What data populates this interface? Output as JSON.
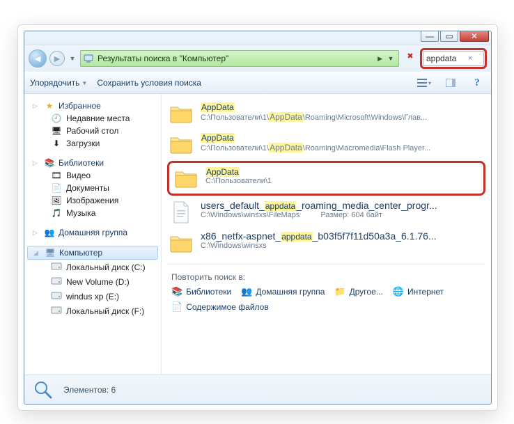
{
  "window_controls": {
    "min": "—",
    "max": "▭",
    "close": "✕"
  },
  "address": {
    "text": "Результаты поиска в \"Компьютер\"",
    "stop_tooltip": "Остановить"
  },
  "search": {
    "value": "appdata",
    "clear": "×"
  },
  "toolbar": {
    "organize": "Упорядочить",
    "save_conditions": "Сохранить условия поиска",
    "help_glyph": "?"
  },
  "sidebar": {
    "favorites": {
      "label": "Избранное",
      "items": [
        {
          "label": "Недавние места",
          "icon": "🕘"
        },
        {
          "label": "Рабочий стол",
          "icon": "🖥"
        },
        {
          "label": "Загрузки",
          "icon": "⬇"
        }
      ]
    },
    "libraries": {
      "label": "Библиотеки",
      "items": [
        {
          "label": "Видео",
          "icon": "🎞"
        },
        {
          "label": "Документы",
          "icon": "📄"
        },
        {
          "label": "Изображения",
          "icon": "🖼"
        },
        {
          "label": "Музыка",
          "icon": "🎵"
        }
      ]
    },
    "homegroup": {
      "label": "Домашняя группа"
    },
    "computer": {
      "label": "Компьютер",
      "items": [
        {
          "label": "Локальный диск (C:)"
        },
        {
          "label": "New Volume (D:)"
        },
        {
          "label": "windus xp (E:)"
        },
        {
          "label": "Локальный диск (F:)"
        }
      ]
    }
  },
  "results": [
    {
      "type": "folder",
      "title": "AppData",
      "title_hl": [
        [
          0,
          7
        ]
      ],
      "path_pre": "C:\\Пользователи\\1\\",
      "path_hl": "AppData",
      "path_post": "\\Roaming\\Microsoft\\Windows\\Глав..."
    },
    {
      "type": "folder",
      "title": "AppData",
      "title_hl": [
        [
          0,
          7
        ]
      ],
      "path_pre": "C:\\Пользователи\\1\\",
      "path_hl": "AppData",
      "path_post": "\\Roaming\\Macromedia\\Flash Player..."
    },
    {
      "type": "folder",
      "title": "AppData",
      "title_hl": [
        [
          0,
          7
        ]
      ],
      "path_pre": "C:\\Пользователи\\1",
      "path_hl": "",
      "path_post": "",
      "highlight_row": true
    },
    {
      "type": "file",
      "title_pre": "users_default_",
      "title_hl": "appdata",
      "title_post": "_roaming_media_center_progr...",
      "path": "C:\\Windows\\winsxs\\FileMaps",
      "size_label": "Размер:",
      "size": "604 байт"
    },
    {
      "type": "folder",
      "title_pre": "x86_netfx-aspnet_",
      "title_hl": "appdata",
      "title_post": "_b03f5f7f11d50a3a_6.1.76...",
      "path": "C:\\Windows\\winsxs"
    }
  ],
  "repeat": {
    "label": "Повторить поиск в:",
    "items": [
      {
        "label": "Библиотеки",
        "icon": "📚"
      },
      {
        "label": "Домашняя группа",
        "icon": "👥"
      },
      {
        "label": "Другое...",
        "icon": "📁"
      },
      {
        "label": "Интернет",
        "icon": "🌐"
      }
    ],
    "file_contents": {
      "label": "Содержимое файлов",
      "icon": "📄"
    }
  },
  "status": {
    "label": "Элементов:",
    "count": "6"
  }
}
